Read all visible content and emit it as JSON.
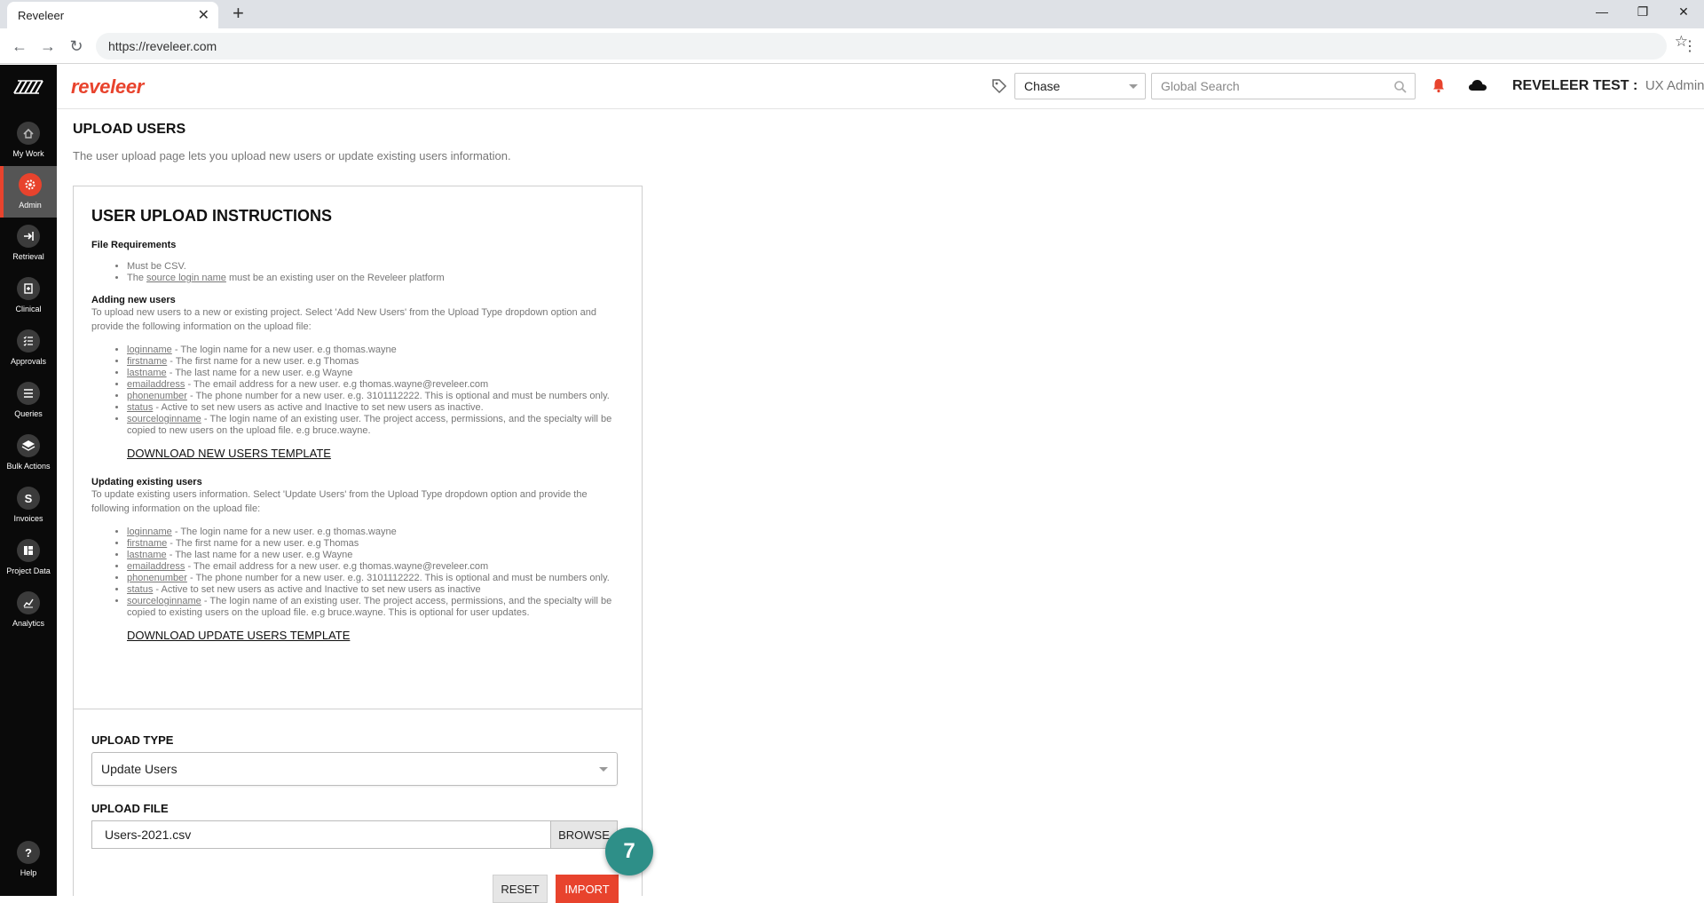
{
  "browser": {
    "tab_title": "Reveleer",
    "url": "https://reveleer.com"
  },
  "sidebar": {
    "items": [
      {
        "label": "My Work",
        "icon": "home-icon"
      },
      {
        "label": "Admin",
        "icon": "gear-icon"
      },
      {
        "label": "Retrieval",
        "icon": "arrow-right-icon"
      },
      {
        "label": "Clinical",
        "icon": "clipboard-icon"
      },
      {
        "label": "Approvals",
        "icon": "list-check-icon"
      },
      {
        "label": "Queries",
        "icon": "list-icon"
      },
      {
        "label": "Bulk Actions",
        "icon": "layers-icon"
      },
      {
        "label": "Invoices",
        "icon": "dollar-icon",
        "glyph": "S"
      },
      {
        "label": "Project Data",
        "icon": "grid-icon"
      },
      {
        "label": "Analytics",
        "icon": "chart-icon"
      }
    ],
    "help_label": "Help",
    "active_color": "#e8432d"
  },
  "header": {
    "brand": "reveleer",
    "client_select": "Chase",
    "search_placeholder": "Global Search",
    "user_org": "REVELEER TEST :",
    "user_role": "UX Admin"
  },
  "page": {
    "title": "UPLOAD USERS",
    "description": "The user upload page lets you upload new users or update existing users information."
  },
  "instructions": {
    "title": "USER UPLOAD INSTRUCTIONS",
    "file_req_heading": "File Requirements",
    "file_req": {
      "csv": "Must be CSV.",
      "source_prefix": "The ",
      "source_link": "source login name",
      "source_suffix": " must be an existing user on the Reveleer platform"
    },
    "adding": {
      "heading": "Adding new users",
      "text": "To upload new users to a new or existing project. Select 'Add New Users' from the Upload Type dropdown option and provide the following information on the upload file:",
      "fields": [
        {
          "name": "loginname",
          "desc": " - The login name for a new user. e.g thomas.wayne"
        },
        {
          "name": "firstname",
          "desc": " - The first name for a new user. e.g Thomas"
        },
        {
          "name": "lastname",
          "desc": " - The last name for a new user. e.g Wayne"
        },
        {
          "name": "emailaddress",
          "desc": " - The email address for a new user. e.g thomas.wayne@reveleer.com"
        },
        {
          "name": "phonenumber",
          "desc": " - The phone number for a new user. e.g. 3101112222. This is optional and must be numbers only."
        },
        {
          "name": "status",
          "desc": " - Active to set new users as active and Inactive to set new users as inactive."
        },
        {
          "name": "sourceloginname",
          "desc": " - The login name of an existing user. The project access, permissions, and the specialty will be copied to new users on the upload file. e.g bruce.wayne."
        }
      ],
      "download_label": "DOWNLOAD NEW USERS TEMPLATE"
    },
    "updating": {
      "heading": "Updating existing users",
      "text": "To update existing users information. Select 'Update Users' from the Upload Type dropdown option and provide the following information on the upload file:",
      "fields": [
        {
          "name": "loginname",
          "desc": " - The login name for a new user. e.g thomas.wayne"
        },
        {
          "name": "firstname",
          "desc": " - The first name for a new user. e.g Thomas"
        },
        {
          "name": "lastname",
          "desc": " - The last name for a new user. e.g Wayne"
        },
        {
          "name": "emailaddress",
          "desc": " - The email address for a new user. e.g thomas.wayne@reveleer.com"
        },
        {
          "name": "phonenumber",
          "desc": " - The phone number for a new user. e.g. 3101112222. This is optional and must be numbers only."
        },
        {
          "name": "status",
          "desc": " - Active to set new users as active and Inactive to set new users as inactive"
        },
        {
          "name": "sourceloginname",
          "desc": " - The login name of an existing user. The project access, permissions, and the specialty will be copied to existing users on the upload file. e.g bruce.wayne. This is optional for user updates."
        }
      ],
      "download_label": "DOWNLOAD UPDATE USERS TEMPLATE"
    }
  },
  "form": {
    "upload_type_label": "UPLOAD TYPE",
    "upload_type_value": "Update Users",
    "upload_file_label": "UPLOAD FILE",
    "upload_file_value": "Users-2021.csv",
    "browse_label": "BROWSE",
    "reset_label": "RESET",
    "import_label": "IMPORT"
  },
  "step_badge": "7",
  "colors": {
    "accent": "#e8432d",
    "badge": "#2e8f88"
  }
}
